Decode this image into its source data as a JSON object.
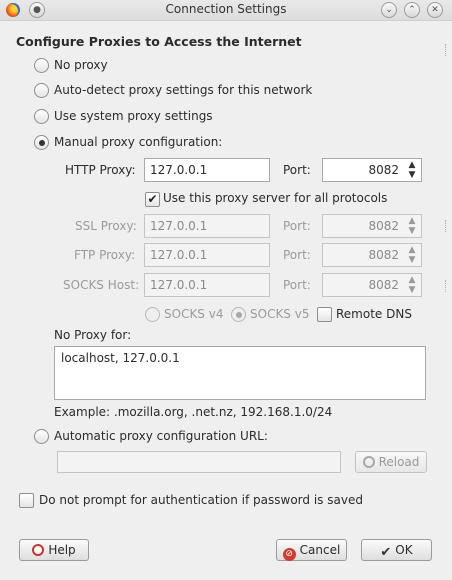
{
  "window": {
    "title": "Connection Settings"
  },
  "heading": "Configure Proxies to Access the Internet",
  "options": {
    "no_proxy": "No proxy",
    "auto_detect": "Auto-detect proxy settings for this network",
    "system": "Use system proxy settings",
    "manual": "Manual proxy configuration:",
    "auto_url": "Automatic proxy configuration URL:"
  },
  "selected_option": "manual",
  "http": {
    "label": "HTTP Proxy:",
    "value": "127.0.0.1",
    "port_label": "Port:",
    "port": "8082"
  },
  "use_for_all": {
    "label": "Use this proxy server for all protocols",
    "checked": true
  },
  "ssl": {
    "label": "SSL Proxy:",
    "value": "127.0.0.1",
    "port_label": "Port:",
    "port": "8082"
  },
  "ftp": {
    "label": "FTP Proxy:",
    "value": "127.0.0.1",
    "port_label": "Port:",
    "port": "8082"
  },
  "socks": {
    "label": "SOCKS Host:",
    "value": "127.0.0.1",
    "port_label": "Port:",
    "port": "8082",
    "v4_label": "SOCKS v4",
    "v5_label": "SOCKS v5",
    "version_selected": "v5",
    "remote_dns_label": "Remote DNS"
  },
  "no_proxy_for": {
    "label": "No Proxy for:",
    "value": "localhost, 127.0.0.1"
  },
  "example": "Example: .mozilla.org, .net.nz, 192.168.1.0/24",
  "auto_url": {
    "value": "",
    "reload_label": "Reload"
  },
  "no_prompt": {
    "label": "Do not prompt for authentication if password is saved",
    "checked": false
  },
  "buttons": {
    "help": "Help",
    "cancel": "Cancel",
    "ok": "OK"
  },
  "titlebar": {
    "shade_glyph": "⌄",
    "up_glyph": "⌃",
    "close_glyph": "✕"
  },
  "icons": {
    "firefox": "firefox-icon",
    "help": "help-icon",
    "cancel": "cancel-icon",
    "ok": "checkmark-icon",
    "reload": "reload-icon"
  }
}
